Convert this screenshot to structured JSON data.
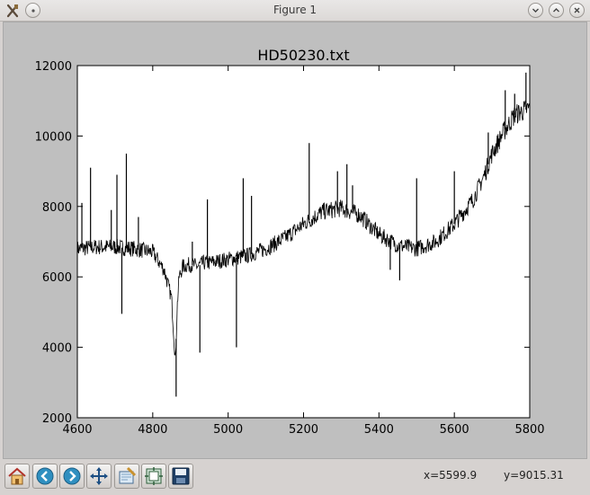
{
  "window": {
    "title": "Figure 1"
  },
  "icons": {
    "app": "x-tools-icon",
    "menu": "window-menu-icon",
    "minimize": "chevron-down-icon",
    "maximize": "chevron-up-icon",
    "close": "close-icon"
  },
  "toolbar": {
    "tools": [
      {
        "name": "home",
        "icon": "home-icon"
      },
      {
        "name": "back",
        "icon": "back-arrow-icon"
      },
      {
        "name": "forward",
        "icon": "forward-arrow-icon"
      },
      {
        "name": "pan",
        "icon": "move-icon"
      },
      {
        "name": "zoom",
        "icon": "zoom-rect-icon"
      },
      {
        "name": "subplots",
        "icon": "subplots-icon"
      },
      {
        "name": "save",
        "icon": "save-icon"
      }
    ],
    "coord_x": "x=5599.9",
    "coord_y": "y=9015.31"
  },
  "chart_data": {
    "type": "line",
    "title": "HD50230.txt",
    "xlabel": "",
    "ylabel": "",
    "xlim": [
      4600,
      5800
    ],
    "ylim": [
      2000,
      12000
    ],
    "xticks": [
      "4600",
      "4800",
      "5000",
      "5200",
      "5400",
      "5600",
      "5800"
    ],
    "yticks": [
      "2000",
      "4000",
      "6000",
      "8000",
      "10000",
      "12000"
    ],
    "grid": false,
    "line_color": "#000000",
    "series": [
      {
        "x": [
          4600,
          4650,
          4700,
          4750,
          4800,
          4830,
          4850,
          4860,
          4865,
          4870,
          4880,
          4900,
          4920,
          4935,
          4950,
          5000,
          5050,
          5100,
          5150,
          5200,
          5250,
          5300,
          5350,
          5400,
          5450,
          5500,
          5550,
          5600,
          5650,
          5680,
          5700,
          5730,
          5760,
          5800
        ],
        "y": [
          6800,
          6850,
          6850,
          6800,
          6700,
          6200,
          5400,
          3600,
          5200,
          6000,
          6300,
          6350,
          6300,
          6400,
          6400,
          6500,
          6600,
          6800,
          7100,
          7500,
          7850,
          7950,
          7750,
          7200,
          6900,
          6800,
          7000,
          7500,
          8200,
          8900,
          9500,
          10100,
          10600,
          10800
        ]
      }
    ],
    "spikes": [
      {
        "x": 4612,
        "y": 8100
      },
      {
        "x": 4635,
        "y": 9100
      },
      {
        "x": 4690,
        "y": 7900
      },
      {
        "x": 4705,
        "y": 8900
      },
      {
        "x": 4718,
        "y": 4950
      },
      {
        "x": 4730,
        "y": 9500
      },
      {
        "x": 4762,
        "y": 7700
      },
      {
        "x": 4862,
        "y": 2600
      },
      {
        "x": 4905,
        "y": 7000
      },
      {
        "x": 4925,
        "y": 3850
      },
      {
        "x": 4945,
        "y": 8200
      },
      {
        "x": 5022,
        "y": 4000
      },
      {
        "x": 5040,
        "y": 8800
      },
      {
        "x": 5062,
        "y": 8300
      },
      {
        "x": 5215,
        "y": 9800
      },
      {
        "x": 5290,
        "y": 9000
      },
      {
        "x": 5315,
        "y": 9200
      },
      {
        "x": 5330,
        "y": 8600
      },
      {
        "x": 5430,
        "y": 6200
      },
      {
        "x": 5455,
        "y": 5900
      },
      {
        "x": 5500,
        "y": 8800
      },
      {
        "x": 5600,
        "y": 9000
      },
      {
        "x": 5690,
        "y": 10100
      },
      {
        "x": 5735,
        "y": 11300
      },
      {
        "x": 5760,
        "y": 11200
      },
      {
        "x": 5790,
        "y": 11800
      }
    ]
  }
}
